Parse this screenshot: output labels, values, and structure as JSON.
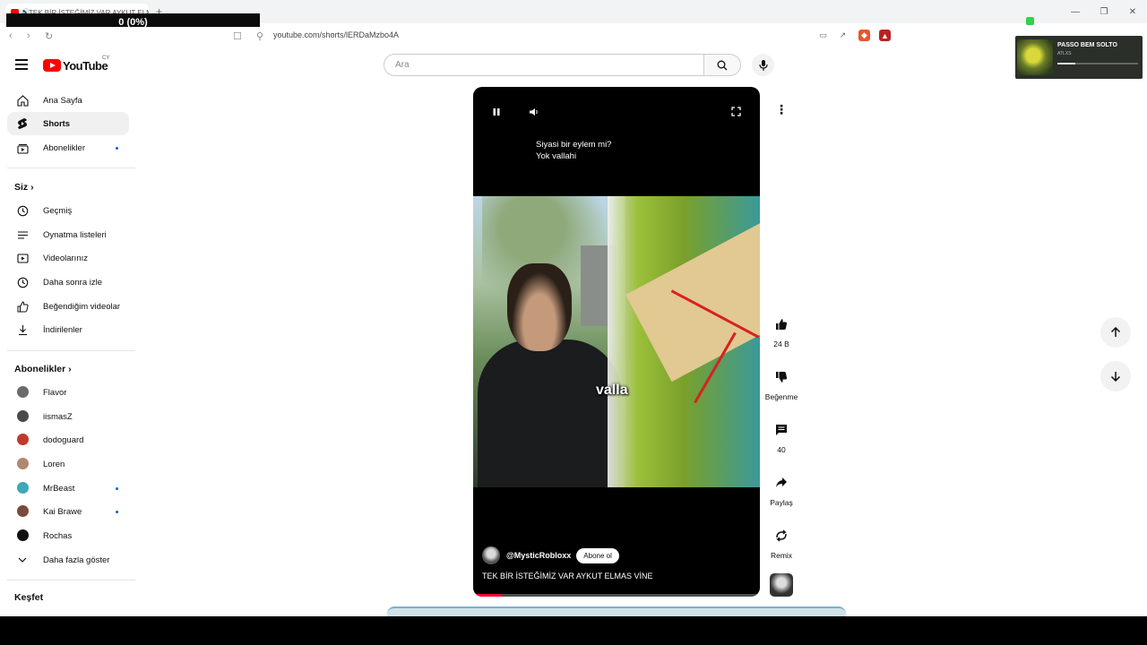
{
  "browser": {
    "tab_title": "TEK BİR İSTEĞİMİZ VAR AYKUT ELMAS VİNE",
    "url": "youtube.com/shorts/lERDaMzbo4A",
    "overlay_counter": "0 (0%)",
    "media_popup": {
      "title": "PASSO BEM SOLTO",
      "artist": "ATLXS"
    }
  },
  "header": {
    "logo_text": "YouTube",
    "country_code": "CY",
    "search_placeholder": "Ara"
  },
  "sidebar": {
    "main": [
      {
        "label": "Ana Sayfa",
        "icon": "home-icon"
      },
      {
        "label": "Shorts",
        "icon": "shorts-icon",
        "active": true
      },
      {
        "label": "Abonelikler",
        "icon": "subscriptions-icon",
        "dot": true
      }
    ],
    "you_heading": "Siz",
    "you": [
      {
        "label": "Geçmiş",
        "icon": "history-icon"
      },
      {
        "label": "Oynatma listeleri",
        "icon": "playlists-icon"
      },
      {
        "label": "Videolarınız",
        "icon": "your-videos-icon"
      },
      {
        "label": "Daha sonra izle",
        "icon": "watch-later-icon"
      },
      {
        "label": "Beğendiğim videolar",
        "icon": "liked-videos-icon"
      },
      {
        "label": "İndirilenler",
        "icon": "downloads-icon"
      }
    ],
    "subs_heading": "Abonelikler",
    "subscriptions": [
      {
        "label": "Flavor",
        "color": "#6b6b6b"
      },
      {
        "label": "iismasZ",
        "color": "#4a4a4a"
      },
      {
        "label": "dodoguard",
        "color": "#c0392b"
      },
      {
        "label": "Loren",
        "color": "#b08870"
      },
      {
        "label": "MrBeast",
        "color": "#3fa7b5",
        "dot": true
      },
      {
        "label": "Kai Brawe",
        "color": "#7a4a3a",
        "dot": true
      },
      {
        "label": "Rochas",
        "color": "#111111"
      }
    ],
    "show_more": "Daha fazla göster",
    "explore_heading": "Keşfet"
  },
  "player": {
    "caption_lines": [
      "Siyasi bir eylem mi?",
      "Yok vallahi"
    ],
    "burned_subtitle": "valla",
    "channel": "@MysticRobloxx",
    "subscribe_label": "Abone ol",
    "title": "TEK BİR İSTEĞİMİZ VAR AYKUT ELMAS VİNE",
    "progress": 0.1
  },
  "actions": {
    "like_count": "24 B",
    "dislike_label": "Beğenme",
    "comment_count": "40",
    "share_label": "Paylaş",
    "remix_label": "Remix"
  },
  "colors": {
    "accent": "#ff0000",
    "progress": "#ff0033",
    "link": "#065fd4"
  }
}
